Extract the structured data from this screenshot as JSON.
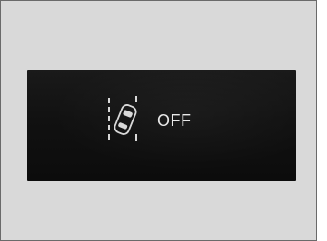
{
  "display": {
    "icon": "lane-departure-vehicle-icon",
    "status_text": "OFF"
  },
  "colors": {
    "panel_background": "#d9d9d9",
    "display_background": "#111111",
    "text": "#e8e8e8"
  }
}
